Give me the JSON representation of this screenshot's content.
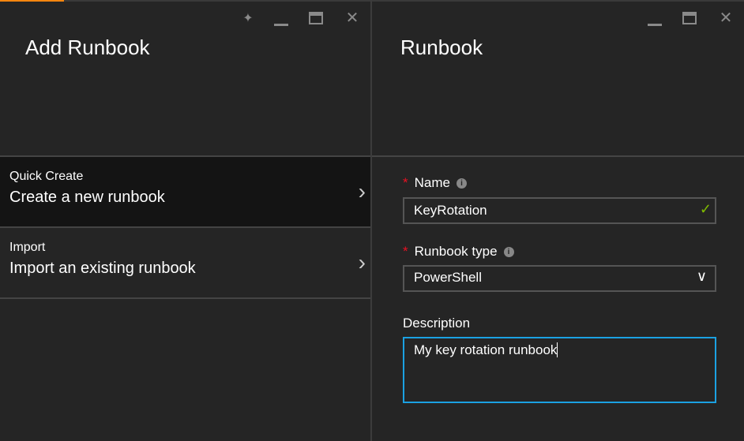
{
  "left_blade": {
    "title": "Add Runbook",
    "items": [
      {
        "label": "Quick Create",
        "sub": "Create a new runbook"
      },
      {
        "label": "Import",
        "sub": "Import an existing runbook"
      }
    ]
  },
  "right_blade": {
    "title": "Runbook",
    "name_label": "Name",
    "name_value": "KeyRotation",
    "type_label": "Runbook type",
    "type_value": "PowerShell",
    "desc_label": "Description",
    "desc_value": "My key rotation runbook"
  },
  "icons": {
    "pin": "📌",
    "close": "✕",
    "chevron": "›",
    "check": "✓",
    "down": "⌄",
    "info": "i",
    "star": "*"
  },
  "colors": {
    "accent": "#f7860f",
    "valid": "#7fba00",
    "focus": "#1ba1e2",
    "required": "#e81123"
  }
}
